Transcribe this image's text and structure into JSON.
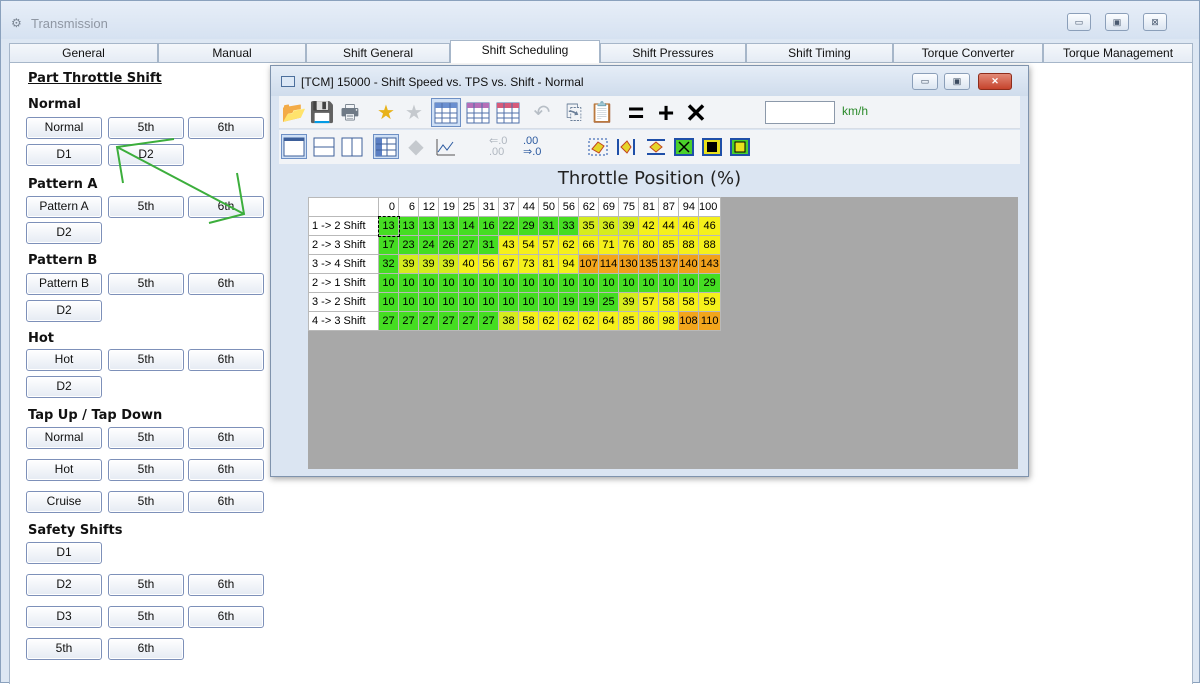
{
  "app": {
    "title": "Transmission"
  },
  "window_controls": {
    "minimize": "▭",
    "restore": "▣",
    "close": "⊠"
  },
  "tabs": [
    {
      "label": "General"
    },
    {
      "label": "Manual"
    },
    {
      "label": "Shift General"
    },
    {
      "label": "Shift Scheduling"
    },
    {
      "label": "Shift Pressures"
    },
    {
      "label": "Shift Timing"
    },
    {
      "label": "Torque Converter"
    },
    {
      "label": "Torque Management"
    }
  ],
  "left_panel": {
    "part_throttle_shift": "Part Throttle Shift",
    "normal": {
      "header": "Normal",
      "buttons": [
        "Normal",
        "5th",
        "6th",
        "D1",
        "D2"
      ]
    },
    "pattern_a": {
      "header": "Pattern A",
      "buttons": [
        "Pattern A",
        "5th",
        "6th",
        "D2"
      ]
    },
    "pattern_b": {
      "header": "Pattern B",
      "buttons": [
        "Pattern B",
        "5th",
        "6th",
        "D2"
      ]
    },
    "hot": {
      "header": "Hot",
      "buttons": [
        "Hot",
        "5th",
        "6th",
        "D2"
      ]
    },
    "tap": {
      "header": "Tap Up / Tap Down",
      "rows": [
        [
          "Normal",
          "5th",
          "6th"
        ],
        [
          "Hot",
          "5th",
          "6th"
        ],
        [
          "Cruise",
          "5th",
          "6th"
        ]
      ]
    },
    "safety": {
      "header": "Safety Shifts",
      "rows": [
        [
          "D1"
        ],
        [
          "D2",
          "5th",
          "6th"
        ],
        [
          "D3",
          "5th",
          "6th"
        ],
        [
          "5th",
          "6th"
        ]
      ]
    }
  },
  "child_window": {
    "title": "[TCM] 15000 - Shift Speed vs. TPS vs. Shift - Normal",
    "unit_label": "km/h",
    "unit_input": "",
    "axis_title": "Throttle Position (%)"
  },
  "chart_data": {
    "type": "table",
    "title": "Throttle Position (%)",
    "columns": [
      0,
      6,
      12,
      19,
      25,
      31,
      37,
      44,
      50,
      56,
      62,
      69,
      75,
      81,
      87,
      94,
      100
    ],
    "rows": [
      {
        "name": "1 -> 2 Shift",
        "values": [
          13,
          13,
          13,
          13,
          14,
          16,
          22,
          29,
          31,
          33,
          35,
          36,
          39,
          42,
          44,
          46,
          46
        ]
      },
      {
        "name": "2 -> 3 Shift",
        "values": [
          17,
          23,
          24,
          26,
          27,
          31,
          43,
          54,
          57,
          62,
          66,
          71,
          76,
          80,
          85,
          88,
          88
        ]
      },
      {
        "name": "3 -> 4 Shift",
        "values": [
          32,
          39,
          39,
          39,
          40,
          56,
          67,
          73,
          81,
          94,
          107,
          114,
          130,
          135,
          137,
          140,
          143
        ]
      },
      {
        "name": "2 -> 1 Shift",
        "values": [
          10,
          10,
          10,
          10,
          10,
          10,
          10,
          10,
          10,
          10,
          10,
          10,
          10,
          10,
          10,
          10,
          29
        ]
      },
      {
        "name": "3 -> 2 Shift",
        "values": [
          10,
          10,
          10,
          10,
          10,
          10,
          10,
          10,
          10,
          19,
          19,
          25,
          39,
          57,
          58,
          58,
          59
        ]
      },
      {
        "name": "4 -> 3 Shift",
        "values": [
          27,
          27,
          27,
          27,
          27,
          27,
          38,
          58,
          62,
          62,
          62,
          64,
          85,
          86,
          98,
          108,
          110
        ]
      }
    ],
    "unit": "km/h"
  }
}
